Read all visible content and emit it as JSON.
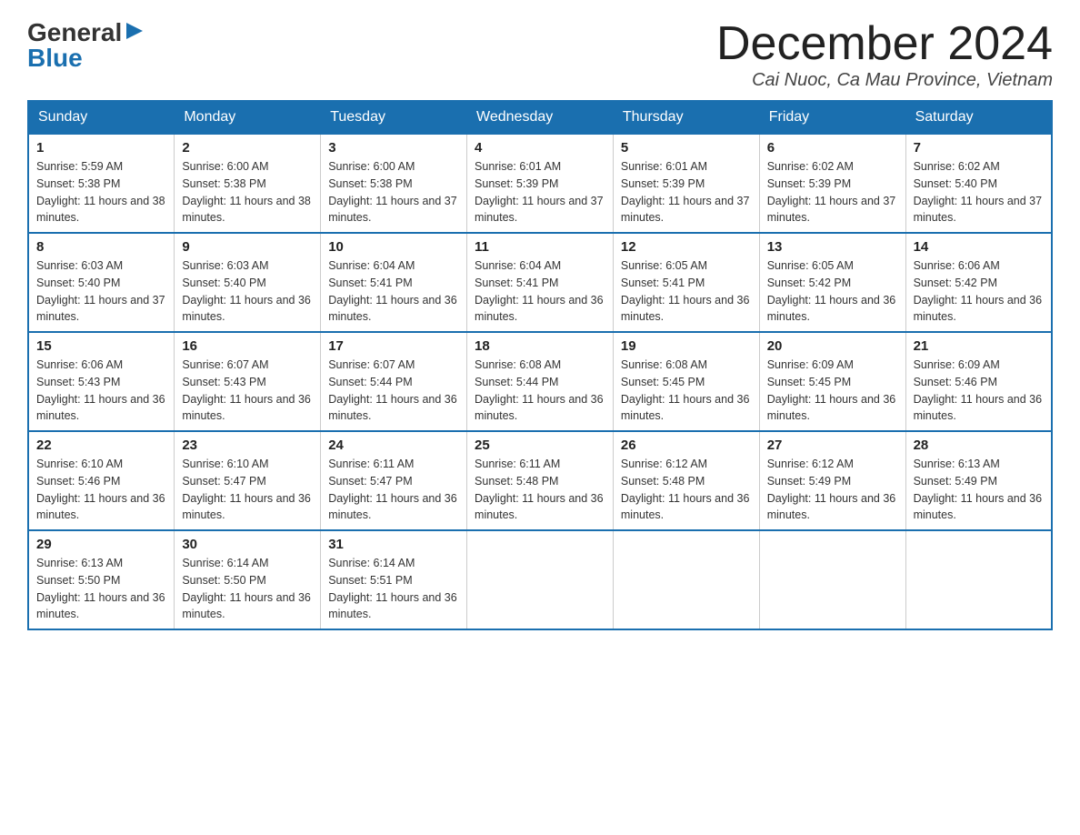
{
  "header": {
    "logo": {
      "general": "General",
      "blue": "Blue",
      "arrow": "▶"
    },
    "title": "December 2024",
    "location": "Cai Nuoc, Ca Mau Province, Vietnam"
  },
  "calendar": {
    "days": [
      "Sunday",
      "Monday",
      "Tuesday",
      "Wednesday",
      "Thursday",
      "Friday",
      "Saturday"
    ],
    "weeks": [
      [
        {
          "day": "1",
          "sunrise": "5:59 AM",
          "sunset": "5:38 PM",
          "daylight": "11 hours and 38 minutes."
        },
        {
          "day": "2",
          "sunrise": "6:00 AM",
          "sunset": "5:38 PM",
          "daylight": "11 hours and 38 minutes."
        },
        {
          "day": "3",
          "sunrise": "6:00 AM",
          "sunset": "5:38 PM",
          "daylight": "11 hours and 37 minutes."
        },
        {
          "day": "4",
          "sunrise": "6:01 AM",
          "sunset": "5:39 PM",
          "daylight": "11 hours and 37 minutes."
        },
        {
          "day": "5",
          "sunrise": "6:01 AM",
          "sunset": "5:39 PM",
          "daylight": "11 hours and 37 minutes."
        },
        {
          "day": "6",
          "sunrise": "6:02 AM",
          "sunset": "5:39 PM",
          "daylight": "11 hours and 37 minutes."
        },
        {
          "day": "7",
          "sunrise": "6:02 AM",
          "sunset": "5:40 PM",
          "daylight": "11 hours and 37 minutes."
        }
      ],
      [
        {
          "day": "8",
          "sunrise": "6:03 AM",
          "sunset": "5:40 PM",
          "daylight": "11 hours and 37 minutes."
        },
        {
          "day": "9",
          "sunrise": "6:03 AM",
          "sunset": "5:40 PM",
          "daylight": "11 hours and 36 minutes."
        },
        {
          "day": "10",
          "sunrise": "6:04 AM",
          "sunset": "5:41 PM",
          "daylight": "11 hours and 36 minutes."
        },
        {
          "day": "11",
          "sunrise": "6:04 AM",
          "sunset": "5:41 PM",
          "daylight": "11 hours and 36 minutes."
        },
        {
          "day": "12",
          "sunrise": "6:05 AM",
          "sunset": "5:41 PM",
          "daylight": "11 hours and 36 minutes."
        },
        {
          "day": "13",
          "sunrise": "6:05 AM",
          "sunset": "5:42 PM",
          "daylight": "11 hours and 36 minutes."
        },
        {
          "day": "14",
          "sunrise": "6:06 AM",
          "sunset": "5:42 PM",
          "daylight": "11 hours and 36 minutes."
        }
      ],
      [
        {
          "day": "15",
          "sunrise": "6:06 AM",
          "sunset": "5:43 PM",
          "daylight": "11 hours and 36 minutes."
        },
        {
          "day": "16",
          "sunrise": "6:07 AM",
          "sunset": "5:43 PM",
          "daylight": "11 hours and 36 minutes."
        },
        {
          "day": "17",
          "sunrise": "6:07 AM",
          "sunset": "5:44 PM",
          "daylight": "11 hours and 36 minutes."
        },
        {
          "day": "18",
          "sunrise": "6:08 AM",
          "sunset": "5:44 PM",
          "daylight": "11 hours and 36 minutes."
        },
        {
          "day": "19",
          "sunrise": "6:08 AM",
          "sunset": "5:45 PM",
          "daylight": "11 hours and 36 minutes."
        },
        {
          "day": "20",
          "sunrise": "6:09 AM",
          "sunset": "5:45 PM",
          "daylight": "11 hours and 36 minutes."
        },
        {
          "day": "21",
          "sunrise": "6:09 AM",
          "sunset": "5:46 PM",
          "daylight": "11 hours and 36 minutes."
        }
      ],
      [
        {
          "day": "22",
          "sunrise": "6:10 AM",
          "sunset": "5:46 PM",
          "daylight": "11 hours and 36 minutes."
        },
        {
          "day": "23",
          "sunrise": "6:10 AM",
          "sunset": "5:47 PM",
          "daylight": "11 hours and 36 minutes."
        },
        {
          "day": "24",
          "sunrise": "6:11 AM",
          "sunset": "5:47 PM",
          "daylight": "11 hours and 36 minutes."
        },
        {
          "day": "25",
          "sunrise": "6:11 AM",
          "sunset": "5:48 PM",
          "daylight": "11 hours and 36 minutes."
        },
        {
          "day": "26",
          "sunrise": "6:12 AM",
          "sunset": "5:48 PM",
          "daylight": "11 hours and 36 minutes."
        },
        {
          "day": "27",
          "sunrise": "6:12 AM",
          "sunset": "5:49 PM",
          "daylight": "11 hours and 36 minutes."
        },
        {
          "day": "28",
          "sunrise": "6:13 AM",
          "sunset": "5:49 PM",
          "daylight": "11 hours and 36 minutes."
        }
      ],
      [
        {
          "day": "29",
          "sunrise": "6:13 AM",
          "sunset": "5:50 PM",
          "daylight": "11 hours and 36 minutes."
        },
        {
          "day": "30",
          "sunrise": "6:14 AM",
          "sunset": "5:50 PM",
          "daylight": "11 hours and 36 minutes."
        },
        {
          "day": "31",
          "sunrise": "6:14 AM",
          "sunset": "5:51 PM",
          "daylight": "11 hours and 36 minutes."
        },
        null,
        null,
        null,
        null
      ]
    ]
  }
}
